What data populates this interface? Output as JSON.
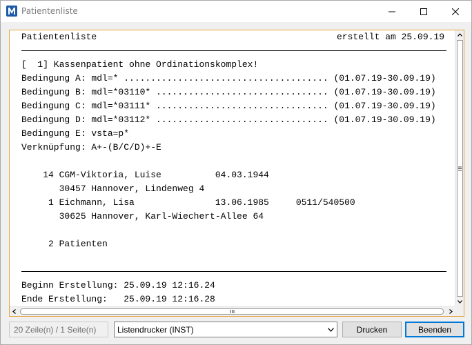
{
  "window": {
    "title": "Patientenliste"
  },
  "report": {
    "header_left": "Patientenliste",
    "header_right": "erstellt am 25.09.19",
    "lines": [
      "[  1] Kassenpatient ohne Ordinationskomplex!",
      "Bedingung A: mdl=* ...................................... (01.07.19-30.09.19)",
      "Bedingung B: mdl=*03110* ................................ (01.07.19-30.09.19)",
      "Bedingung C: mdl=*03111* ................................ (01.07.19-30.09.19)",
      "Bedingung D: mdl=*03112* ................................ (01.07.19-30.09.19)",
      "Bedingung E: vsta=p*",
      "Verknüpfung: A+-(B/C/D)+-E",
      "",
      "    14 CGM-Viktoria, Luise          04.03.1944",
      "       30457 Hannover, Lindenweg 4",
      "     1 Eichmann, Lisa               13.06.1985     0511/540500",
      "       30625 Hannover, Karl-Wiechert-Allee 64",
      "",
      "     2 Patienten"
    ],
    "footer_lines": [
      "Beginn Erstellung: 25.09.19 12:16.24",
      "Ende Erstellung:   25.09.19 12:16.28"
    ]
  },
  "statusbar": {
    "page_info": "20 Zeile(n) / 1 Seite(n)",
    "printer_selected": "Listendrucker (INST)",
    "print_button": "Drucken",
    "close_button": "Beenden"
  },
  "icons": {
    "app": "app-logo-icon",
    "minimize": "minimize-icon",
    "maximize": "maximize-icon",
    "close": "close-icon",
    "dropdown": "chevron-down-icon"
  },
  "colors": {
    "report_border": "#e3a33a",
    "focus_button_border": "#0078d7",
    "app_icon": "#1c5aa8"
  }
}
